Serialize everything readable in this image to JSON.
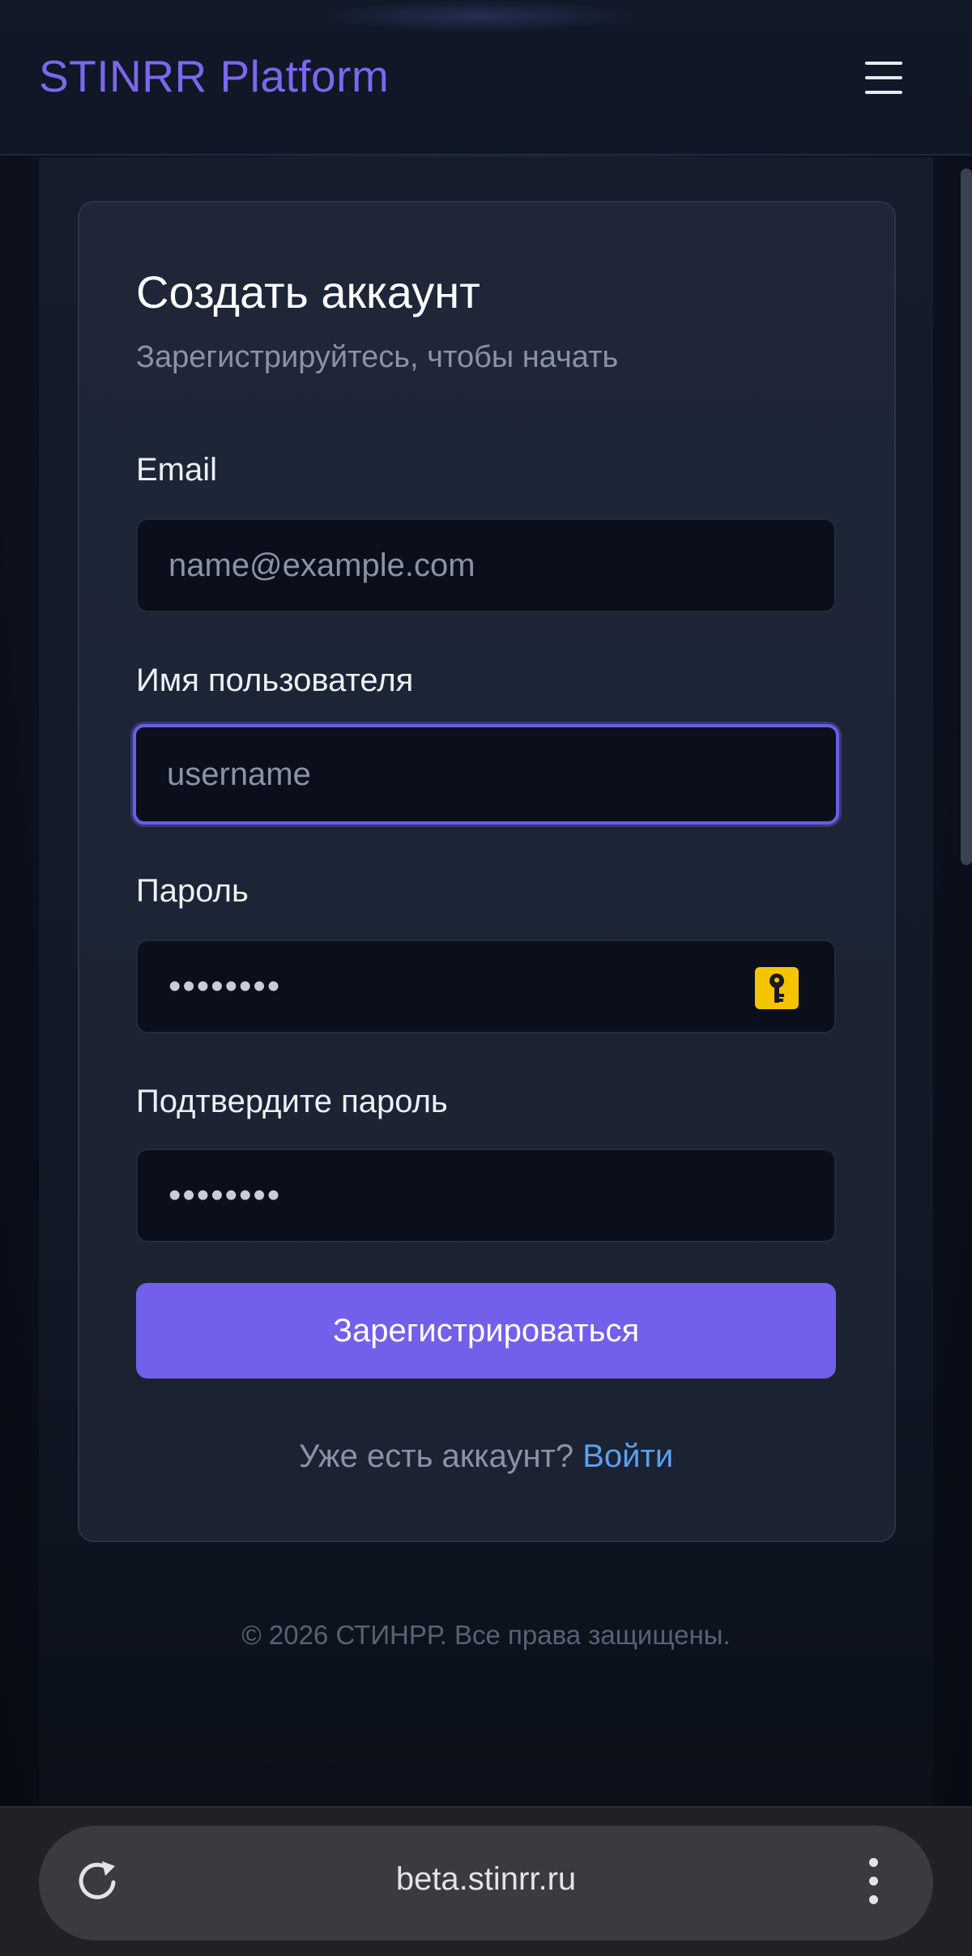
{
  "header": {
    "brand": "STINRR Platform",
    "menu_icon": "hamburger-menu-icon"
  },
  "form": {
    "title": "Создать аккаунт",
    "subtitle": "Зарегистрируйтесь, чтобы начать",
    "email": {
      "label": "Email",
      "placeholder": "name@example.com",
      "value": ""
    },
    "username": {
      "label": "Имя пользователя",
      "placeholder": "username",
      "value": ""
    },
    "password": {
      "label": "Пароль",
      "value": "••••••••",
      "icon": "password-manager-key-icon"
    },
    "confirm_password": {
      "label": "Подтвердите пароль",
      "value": "••••••••"
    },
    "submit_label": "Зарегистрироваться",
    "login_prompt": "Уже есть аккаунт?",
    "login_link": "Войти"
  },
  "footer": {
    "copyright": "© 2026 СТИНРР. Все права защищены."
  },
  "browser": {
    "url": "beta.stinrr.ru",
    "reload_icon": "reload-icon",
    "menu_icon": "kebab-menu-icon"
  },
  "colors": {
    "accent": "#7360ea",
    "focus_border": "#6c5ce7",
    "link": "#5aa0f0",
    "key_badge": "#f5c400"
  }
}
